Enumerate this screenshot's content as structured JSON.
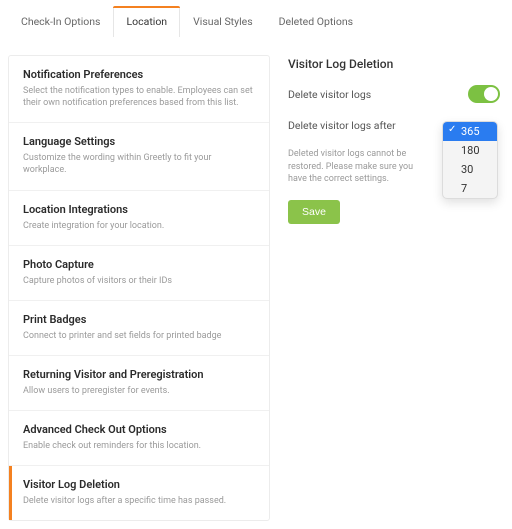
{
  "tabs": {
    "checkin": "Check-In Options",
    "location": "Location",
    "visual": "Visual Styles",
    "deleted": "Deleted Options"
  },
  "sidebar": [
    {
      "title": "Notification Preferences",
      "desc": "Select the notification types to enable. Employees can set their own notification preferences based from this list."
    },
    {
      "title": "Language Settings",
      "desc": "Customize the wording within Greetly to fit your workplace."
    },
    {
      "title": "Location Integrations",
      "desc": "Create integration for your location."
    },
    {
      "title": "Photo Capture",
      "desc": "Capture photos of visitors or their IDs"
    },
    {
      "title": "Print Badges",
      "desc": "Connect to printer and set fields for printed badge"
    },
    {
      "title": "Returning Visitor and Preregistration",
      "desc": "Allow users to preregister for events."
    },
    {
      "title": "Advanced Check Out Options",
      "desc": "Enable check out reminders for this location."
    },
    {
      "title": "Visitor Log Deletion",
      "desc": "Delete visitor logs after a specific time has passed."
    }
  ],
  "panel": {
    "title": "Visitor Log Deletion",
    "toggle_label": "Delete visitor logs",
    "after_label": "Delete visitor logs after",
    "help": "Deleted visitor logs cannot be restored. Please make sure you have the correct settings.",
    "save": "Save",
    "options": {
      "o365": "365",
      "o180": "180",
      "o30": "30",
      "o7": "7"
    }
  }
}
